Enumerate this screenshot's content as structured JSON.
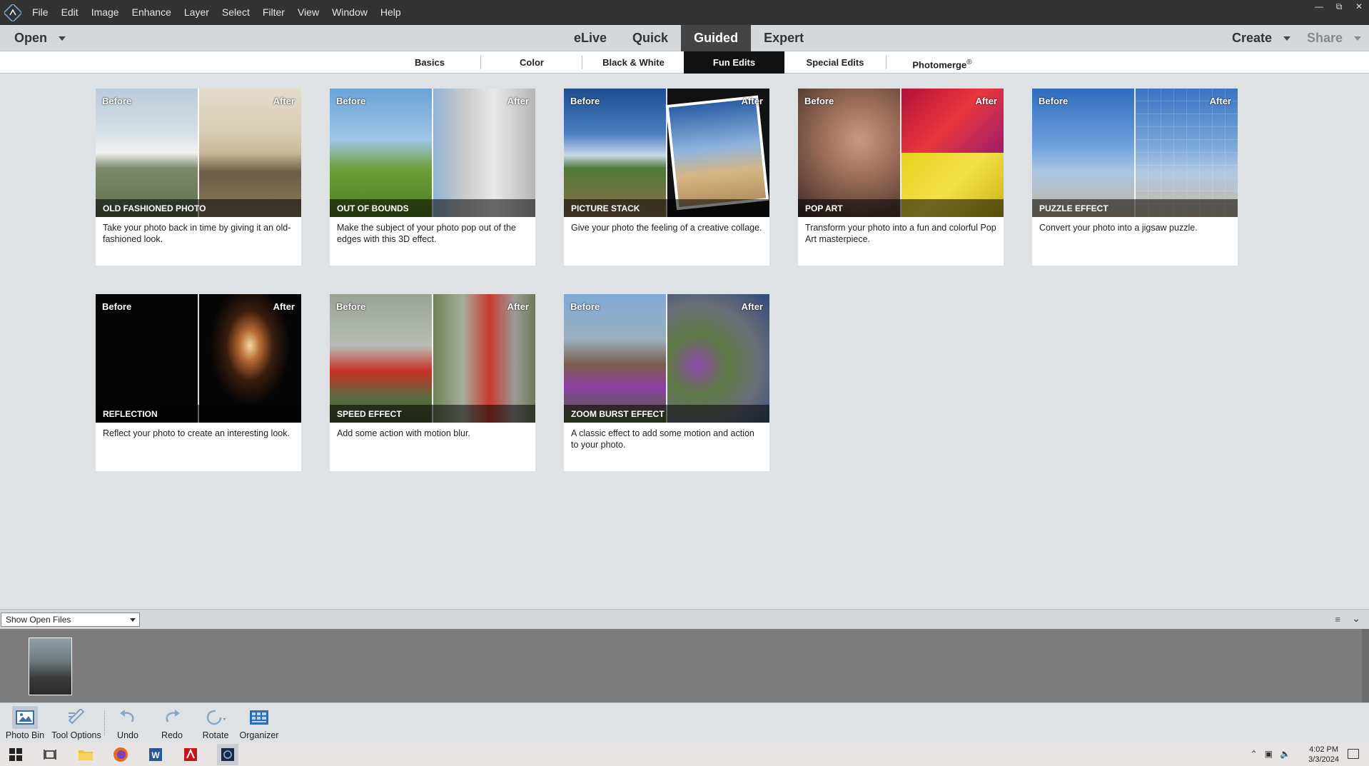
{
  "menubar": {
    "items": [
      "File",
      "Edit",
      "Image",
      "Enhance",
      "Layer",
      "Select",
      "Filter",
      "View",
      "Window",
      "Help"
    ]
  },
  "modebar": {
    "open_label": "Open",
    "tabs": [
      "eLive",
      "Quick",
      "Guided",
      "Expert"
    ],
    "active_tab": "Guided",
    "create_label": "Create",
    "share_label": "Share"
  },
  "subtabs": {
    "items": [
      "Basics",
      "Color",
      "Black & White",
      "Fun Edits",
      "Special Edits",
      "Photomerge"
    ],
    "photomerge_mark": "®",
    "active": "Fun Edits"
  },
  "cards": [
    {
      "before": "Before",
      "after": "After",
      "title": "OLD FASHIONED PHOTO",
      "desc": "Take your photo back in time by giving it an old-fashioned look."
    },
    {
      "before": "Before",
      "after": "After",
      "title": "OUT OF BOUNDS",
      "desc": "Make the subject of your photo pop out of the edges with this 3D effect."
    },
    {
      "before": "Before",
      "after": "After",
      "title": "PICTURE STACK",
      "desc": "Give your photo the feeling of a creative collage."
    },
    {
      "before": "Before",
      "after": "After",
      "title": "POP ART",
      "desc": "Transform your photo into a fun and colorful Pop Art masterpiece."
    },
    {
      "before": "Before",
      "after": "After",
      "title": "PUZZLE EFFECT",
      "desc": "Convert your photo into a jigsaw puzzle."
    },
    {
      "before": "Before",
      "after": "After",
      "title": "REFLECTION",
      "desc": "Reflect your photo to create an interesting look."
    },
    {
      "before": "Before",
      "after": "After",
      "title": "SPEED EFFECT",
      "desc": "Add some action with motion blur."
    },
    {
      "before": "Before",
      "after": "After",
      "title": "ZOOM BURST EFFECT",
      "desc": "A classic effect to add some motion and action to your photo."
    }
  ],
  "photobin": {
    "show_label": "Show Open Files"
  },
  "toolbar": {
    "items": [
      "Photo Bin",
      "Tool Options",
      "Undo",
      "Redo",
      "Rotate",
      "Organizer"
    ]
  },
  "taskbar": {
    "time": "4:02 PM",
    "date": "3/3/2024"
  },
  "colors": {
    "menubar": "#323232",
    "active_mode": "#444444",
    "active_subtab": "#111111",
    "canvas": "#dfe2e5",
    "photobin": "#7c7c7c"
  }
}
